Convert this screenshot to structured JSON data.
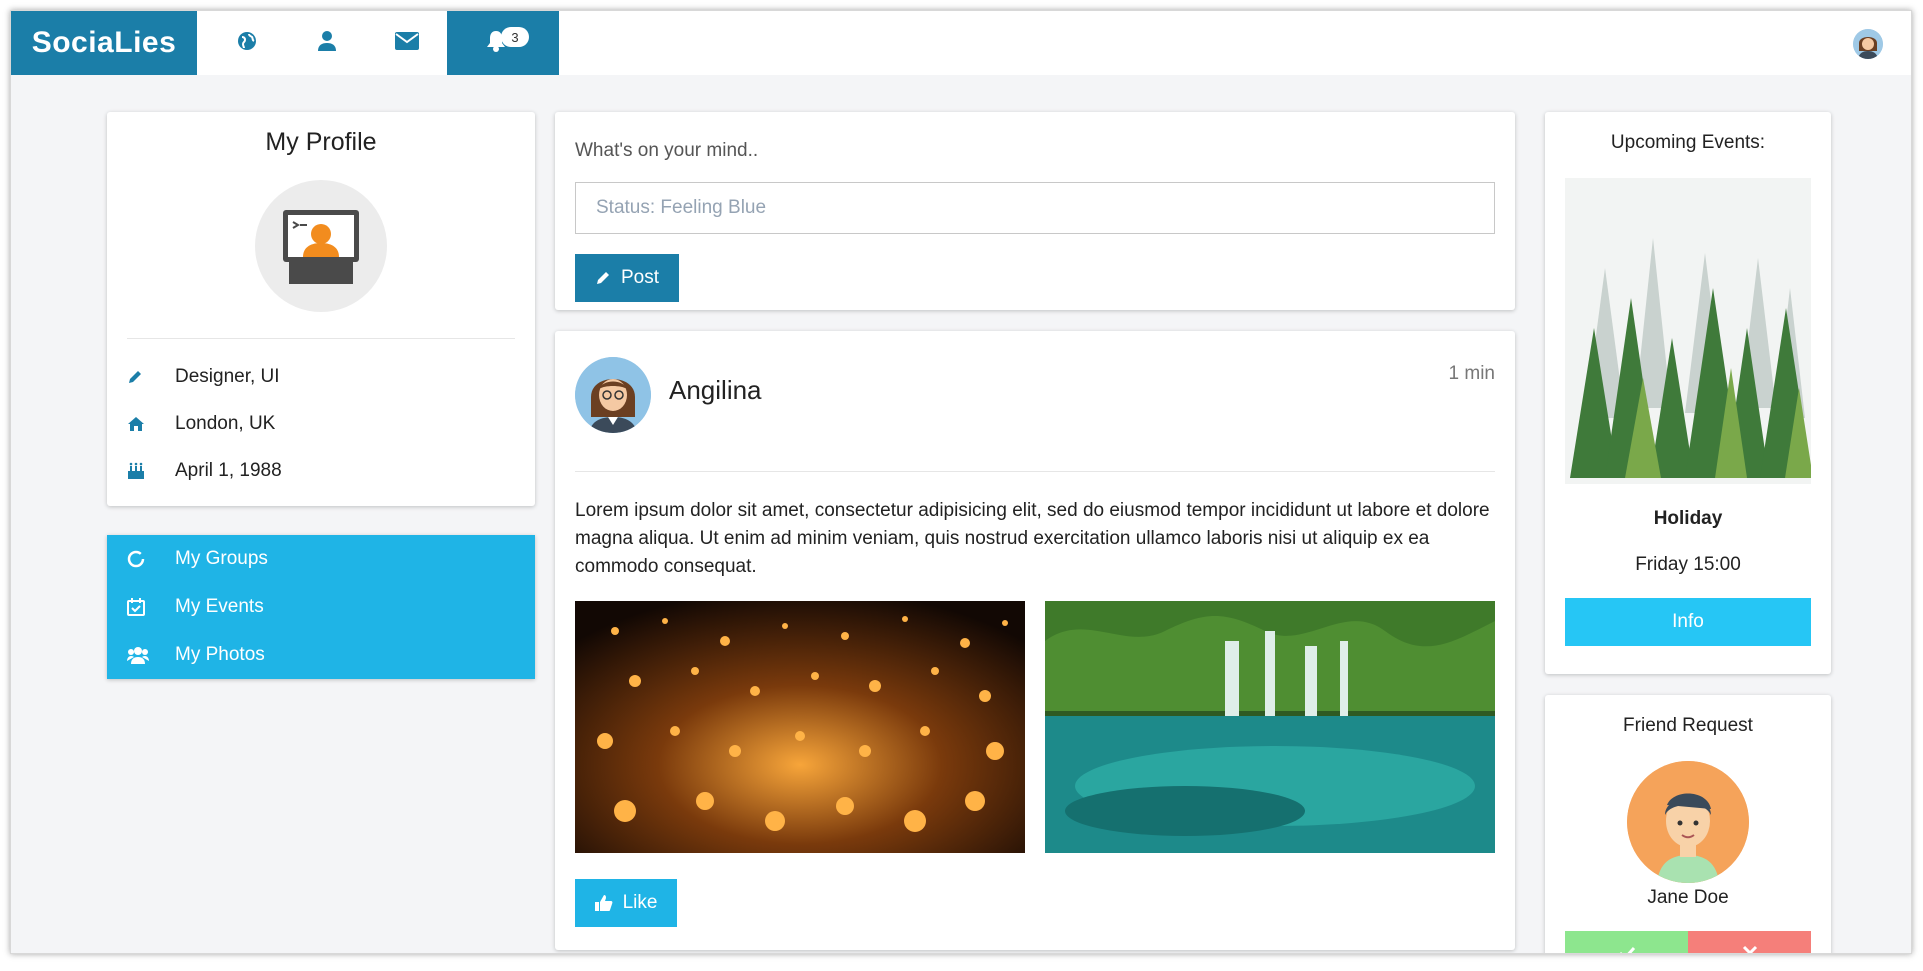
{
  "colors": {
    "brand": "#1b7ea8",
    "accent_light": "#1fb4e6",
    "info_button": "#26c6f5",
    "accept": "#8de68e",
    "decline": "#f57f7a",
    "background": "#f4f5f7"
  },
  "nav": {
    "brand": "SociaLies",
    "items": [
      {
        "icon": "globe-icon"
      },
      {
        "icon": "user-icon"
      },
      {
        "icon": "envelope-icon"
      },
      {
        "icon": "bell-icon",
        "badge": "3",
        "active": true
      }
    ],
    "avatar_icon": "user-avatar-icon"
  },
  "profile": {
    "title": "My Profile",
    "details": [
      {
        "icon": "pencil-icon",
        "text": "Designer, UI"
      },
      {
        "icon": "home-icon",
        "text": "London, UK"
      },
      {
        "icon": "birthday-cake-icon",
        "text": "April 1, 1988"
      }
    ]
  },
  "menu": [
    {
      "icon": "circle-notch-icon",
      "label": "My Groups"
    },
    {
      "icon": "calendar-check-icon",
      "label": "My Events"
    },
    {
      "icon": "users-icon",
      "label": "My Photos"
    }
  ],
  "composer": {
    "label": "What's on your mind..",
    "input_placeholder": "Status: Feeling Blue",
    "post_label": "Post"
  },
  "post": {
    "author": "Angilina",
    "time": "1 min",
    "text": "Lorem ipsum dolor sit amet, consectetur adipisicing elit, sed do eiusmod tempor incididunt ut labore et dolore magna aliqua. Ut enim ad minim veniam, quis nostrud exercitation ullamco laboris nisi ut aliquip ex ea commodo consequat.",
    "like_label": "Like",
    "photos": [
      "lanterns-photo",
      "waterfall-photo"
    ]
  },
  "events": {
    "title": "Upcoming Events:",
    "name": "Holiday",
    "time": "Friday 15:00",
    "info_label": "Info"
  },
  "friend_request": {
    "title": "Friend Request",
    "name": "Jane Doe"
  }
}
